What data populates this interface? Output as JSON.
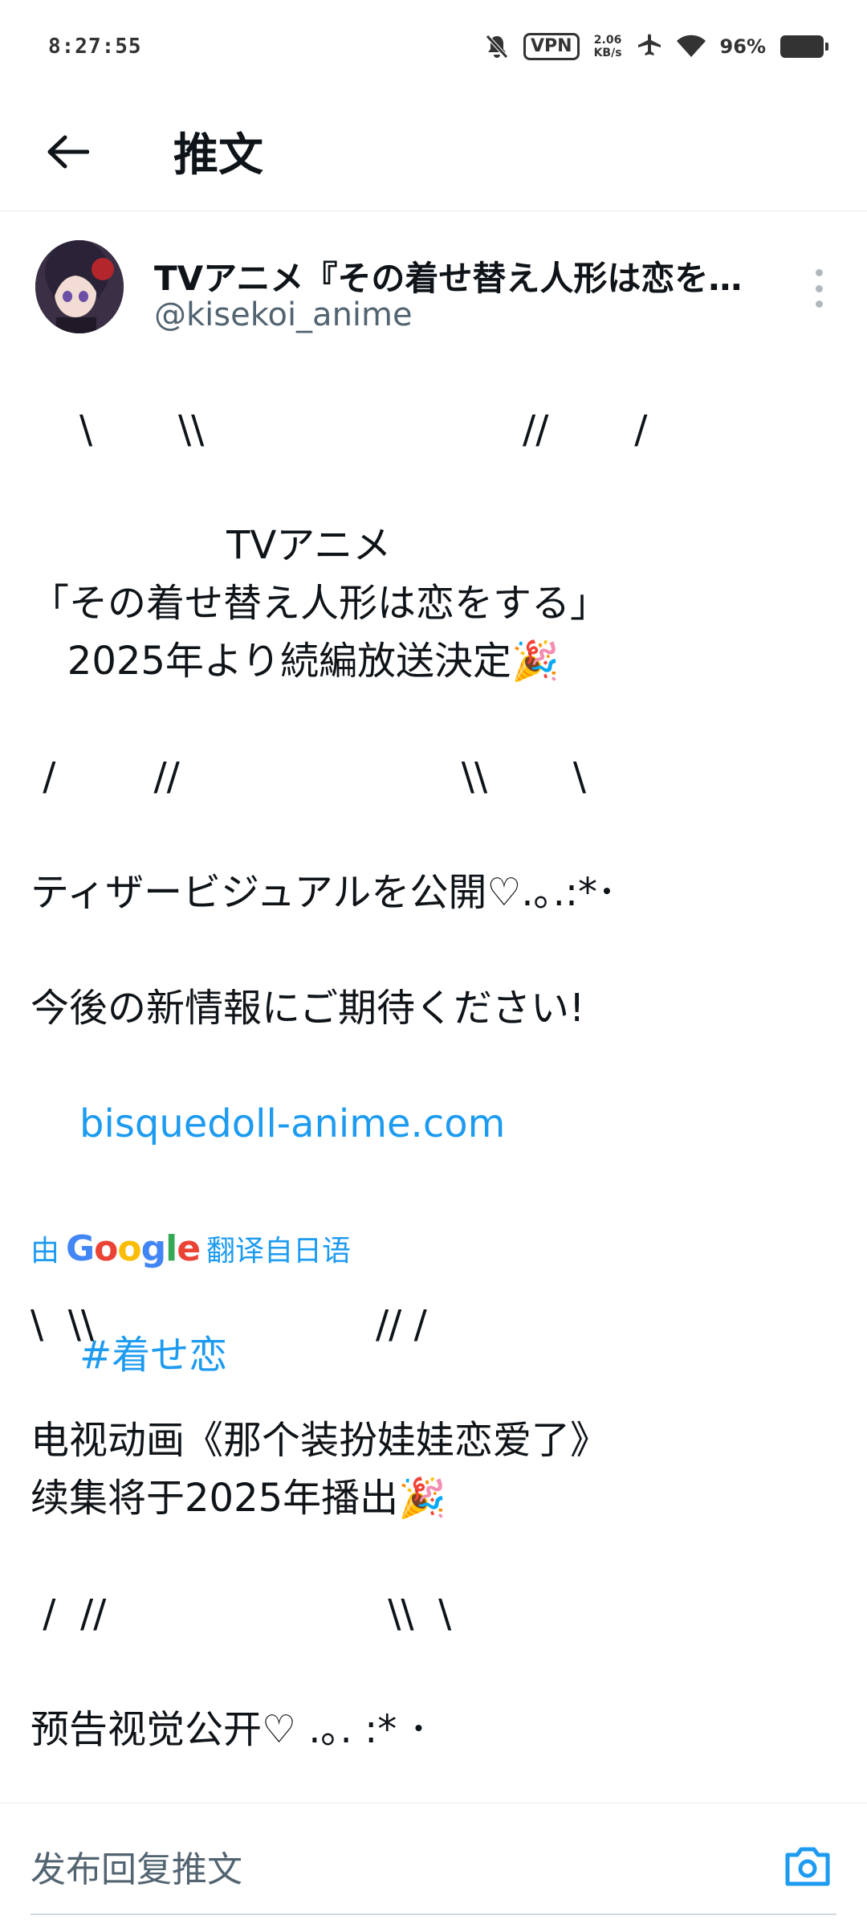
{
  "status_bar": {
    "time": "8:27:55",
    "vpn_label": "VPN",
    "net_speed_value": "2.06",
    "net_speed_unit": "KB/s",
    "battery_pct": "96%",
    "icons": [
      "mute-icon",
      "vpn-icon",
      "airplane-icon",
      "wifi-icon",
      "battery-icon"
    ]
  },
  "header": {
    "title": "推文",
    "back_icon": "arrow-left-icon"
  },
  "tweet": {
    "author_name": "TVアニメ『その着せ替え人形は恋を…",
    "author_handle": "@kisekoi_anime",
    "original_text": "\\       \\\\                          //       /\n\n                TVアニメ\n「その着せ替え人形は恋をする」\n   2025年より続編放送決定🎉\n\n /        //                       \\\\       \\\n\nティザービジュアルを公開♡.｡.:*･\n\n今後の新情報にご期待ください!\n",
    "link": "bisquedoll-anime.com",
    "hashtag": "#着せ恋",
    "translated_by_prefix": "由",
    "translated_by_brand": "Google",
    "translated_by_suffix": "翻译自日语",
    "translated_text": "\\  \\\\                       // /\n\n电视动画《那个装扮娃娃恋爱了》\n续集将于2025年播出🎉\n\n /  //                       \\\\  \\\n\n预告视觉公开♡ .｡. :* ･"
  },
  "reply": {
    "placeholder": "发布回复推文",
    "camera_icon": "camera-icon"
  },
  "colors": {
    "link": "#1d9bf0",
    "text": "#0f1419",
    "secondary": "#536471"
  }
}
